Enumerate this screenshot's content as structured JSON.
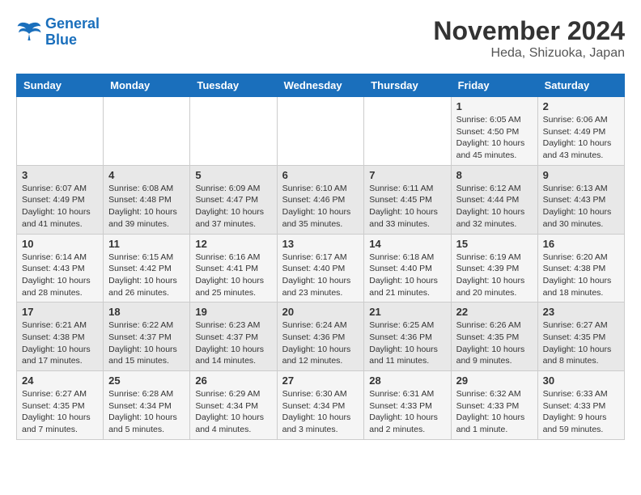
{
  "logo": {
    "line1": "General",
    "line2": "Blue"
  },
  "title": "November 2024",
  "subtitle": "Heda, Shizuoka, Japan",
  "days_of_week": [
    "Sunday",
    "Monday",
    "Tuesday",
    "Wednesday",
    "Thursday",
    "Friday",
    "Saturday"
  ],
  "weeks": [
    [
      {
        "day": "",
        "info": ""
      },
      {
        "day": "",
        "info": ""
      },
      {
        "day": "",
        "info": ""
      },
      {
        "day": "",
        "info": ""
      },
      {
        "day": "",
        "info": ""
      },
      {
        "day": "1",
        "info": "Sunrise: 6:05 AM\nSunset: 4:50 PM\nDaylight: 10 hours\nand 45 minutes."
      },
      {
        "day": "2",
        "info": "Sunrise: 6:06 AM\nSunset: 4:49 PM\nDaylight: 10 hours\nand 43 minutes."
      }
    ],
    [
      {
        "day": "3",
        "info": "Sunrise: 6:07 AM\nSunset: 4:49 PM\nDaylight: 10 hours\nand 41 minutes."
      },
      {
        "day": "4",
        "info": "Sunrise: 6:08 AM\nSunset: 4:48 PM\nDaylight: 10 hours\nand 39 minutes."
      },
      {
        "day": "5",
        "info": "Sunrise: 6:09 AM\nSunset: 4:47 PM\nDaylight: 10 hours\nand 37 minutes."
      },
      {
        "day": "6",
        "info": "Sunrise: 6:10 AM\nSunset: 4:46 PM\nDaylight: 10 hours\nand 35 minutes."
      },
      {
        "day": "7",
        "info": "Sunrise: 6:11 AM\nSunset: 4:45 PM\nDaylight: 10 hours\nand 33 minutes."
      },
      {
        "day": "8",
        "info": "Sunrise: 6:12 AM\nSunset: 4:44 PM\nDaylight: 10 hours\nand 32 minutes."
      },
      {
        "day": "9",
        "info": "Sunrise: 6:13 AM\nSunset: 4:43 PM\nDaylight: 10 hours\nand 30 minutes."
      }
    ],
    [
      {
        "day": "10",
        "info": "Sunrise: 6:14 AM\nSunset: 4:43 PM\nDaylight: 10 hours\nand 28 minutes."
      },
      {
        "day": "11",
        "info": "Sunrise: 6:15 AM\nSunset: 4:42 PM\nDaylight: 10 hours\nand 26 minutes."
      },
      {
        "day": "12",
        "info": "Sunrise: 6:16 AM\nSunset: 4:41 PM\nDaylight: 10 hours\nand 25 minutes."
      },
      {
        "day": "13",
        "info": "Sunrise: 6:17 AM\nSunset: 4:40 PM\nDaylight: 10 hours\nand 23 minutes."
      },
      {
        "day": "14",
        "info": "Sunrise: 6:18 AM\nSunset: 4:40 PM\nDaylight: 10 hours\nand 21 minutes."
      },
      {
        "day": "15",
        "info": "Sunrise: 6:19 AM\nSunset: 4:39 PM\nDaylight: 10 hours\nand 20 minutes."
      },
      {
        "day": "16",
        "info": "Sunrise: 6:20 AM\nSunset: 4:38 PM\nDaylight: 10 hours\nand 18 minutes."
      }
    ],
    [
      {
        "day": "17",
        "info": "Sunrise: 6:21 AM\nSunset: 4:38 PM\nDaylight: 10 hours\nand 17 minutes."
      },
      {
        "day": "18",
        "info": "Sunrise: 6:22 AM\nSunset: 4:37 PM\nDaylight: 10 hours\nand 15 minutes."
      },
      {
        "day": "19",
        "info": "Sunrise: 6:23 AM\nSunset: 4:37 PM\nDaylight: 10 hours\nand 14 minutes."
      },
      {
        "day": "20",
        "info": "Sunrise: 6:24 AM\nSunset: 4:36 PM\nDaylight: 10 hours\nand 12 minutes."
      },
      {
        "day": "21",
        "info": "Sunrise: 6:25 AM\nSunset: 4:36 PM\nDaylight: 10 hours\nand 11 minutes."
      },
      {
        "day": "22",
        "info": "Sunrise: 6:26 AM\nSunset: 4:35 PM\nDaylight: 10 hours\nand 9 minutes."
      },
      {
        "day": "23",
        "info": "Sunrise: 6:27 AM\nSunset: 4:35 PM\nDaylight: 10 hours\nand 8 minutes."
      }
    ],
    [
      {
        "day": "24",
        "info": "Sunrise: 6:27 AM\nSunset: 4:35 PM\nDaylight: 10 hours\nand 7 minutes."
      },
      {
        "day": "25",
        "info": "Sunrise: 6:28 AM\nSunset: 4:34 PM\nDaylight: 10 hours\nand 5 minutes."
      },
      {
        "day": "26",
        "info": "Sunrise: 6:29 AM\nSunset: 4:34 PM\nDaylight: 10 hours\nand 4 minutes."
      },
      {
        "day": "27",
        "info": "Sunrise: 6:30 AM\nSunset: 4:34 PM\nDaylight: 10 hours\nand 3 minutes."
      },
      {
        "day": "28",
        "info": "Sunrise: 6:31 AM\nSunset: 4:33 PM\nDaylight: 10 hours\nand 2 minutes."
      },
      {
        "day": "29",
        "info": "Sunrise: 6:32 AM\nSunset: 4:33 PM\nDaylight: 10 hours\nand 1 minute."
      },
      {
        "day": "30",
        "info": "Sunrise: 6:33 AM\nSunset: 4:33 PM\nDaylight: 9 hours\nand 59 minutes."
      }
    ]
  ]
}
